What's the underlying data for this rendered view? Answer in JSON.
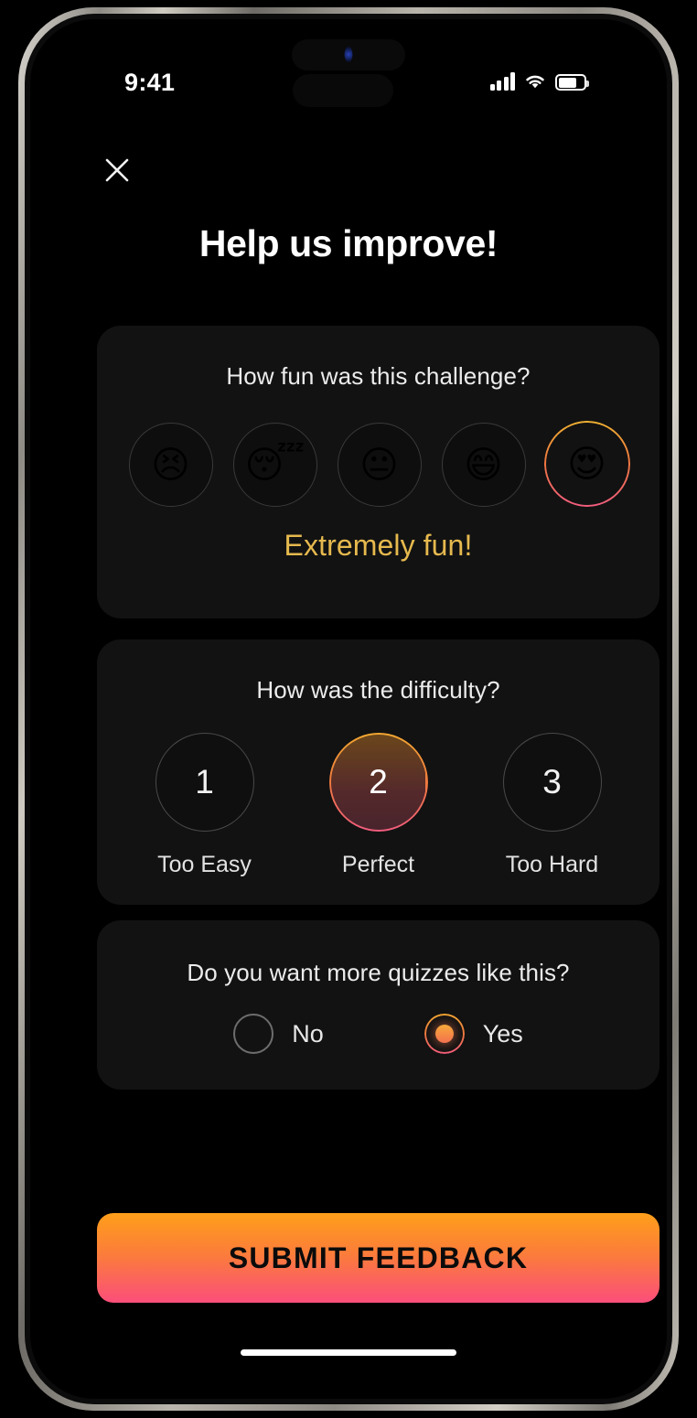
{
  "status_bar": {
    "time": "9:41",
    "signal_icon": "cellular-bars-icon",
    "wifi_icon": "wifi-icon",
    "battery_icon": "battery-icon",
    "battery_level_pct": 75
  },
  "header": {
    "close_icon": "close-icon",
    "title": "Help us improve!"
  },
  "fun_card": {
    "question": "How fun was this challenge?",
    "options": [
      {
        "emoji": "😣",
        "icon_name": "persevering-face-emoji",
        "value": 1,
        "selected": false
      },
      {
        "emoji": "😴",
        "icon_name": "sleeping-face-emoji",
        "value": 2,
        "selected": false
      },
      {
        "emoji": "😐",
        "icon_name": "neutral-face-emoji",
        "value": 3,
        "selected": false
      },
      {
        "emoji": "😄",
        "icon_name": "grinning-face-emoji",
        "value": 4,
        "selected": false
      },
      {
        "emoji": "😍",
        "icon_name": "heart-eyes-emoji",
        "value": 5,
        "selected": true
      }
    ],
    "selected_label": "Extremely fun!",
    "selected_label_color": "#e6b94e"
  },
  "difficulty_card": {
    "question": "How was the difficulty?",
    "options": [
      {
        "number": "1",
        "label": "Too Easy",
        "selected": false
      },
      {
        "number": "2",
        "label": "Perfect",
        "selected": true
      },
      {
        "number": "3",
        "label": "Too Hard",
        "selected": false
      }
    ]
  },
  "more_quizzes_card": {
    "question": "Do you want more quizzes like this?",
    "options": [
      {
        "label": "No",
        "selected": false
      },
      {
        "label": "Yes",
        "selected": true
      }
    ]
  },
  "submit": {
    "label": "SUBMIT FEEDBACK",
    "gradient_start": "#ff9f1a",
    "gradient_end": "#fb4e7b"
  },
  "theme": {
    "background": "#000000",
    "card_background": "#121212",
    "accent_orange": "#f0a832",
    "accent_pink": "#f15c7e"
  }
}
